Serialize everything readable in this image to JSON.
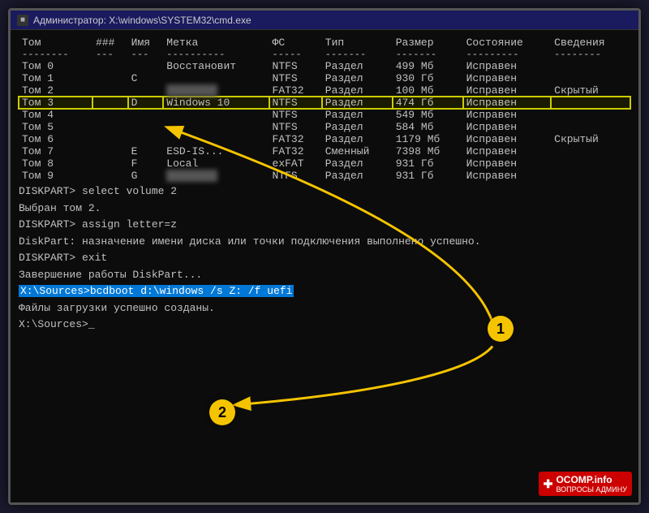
{
  "window": {
    "title": "Администратор: X:\\windows\\SYSTEM32\\cmd.exe"
  },
  "table": {
    "headers": [
      "Том",
      "###",
      "Имя",
      "Метка",
      "ФС",
      "Тип",
      "Размер",
      "Состояние",
      "Сведения"
    ],
    "separator": [
      "--------",
      "---",
      "---",
      "----------",
      "-----",
      "-------",
      "-------",
      "---------",
      "--------"
    ],
    "rows": [
      {
        "tom": "Том 0",
        "num": "",
        "name": "",
        "label": "Восстановит",
        "fs": "NTFS",
        "type": "Раздел",
        "size": "499 Мб",
        "status": "Исправен",
        "info": ""
      },
      {
        "tom": "Том 1",
        "num": "",
        "name": "C",
        "label": "",
        "fs": "NTFS",
        "type": "Раздел",
        "size": "930 Гб",
        "status": "Исправен",
        "info": ""
      },
      {
        "tom": "Том 2",
        "num": "",
        "name": "",
        "label": "",
        "fs": "FAT32",
        "type": "Раздел",
        "size": "100 Мб",
        "status": "Исправен",
        "info": "Скрытый"
      },
      {
        "tom": "Том 3",
        "num": "",
        "name": "D",
        "label": "Windows 10",
        "fs": "NTFS",
        "type": "Раздел",
        "size": "474 Гб",
        "status": "Исправен",
        "info": "",
        "highlight": true
      },
      {
        "tom": "Том 4",
        "num": "",
        "name": "",
        "label": "",
        "fs": "NTFS",
        "type": "Раздел",
        "size": "549 Мб",
        "status": "Исправен",
        "info": ""
      },
      {
        "tom": "Том 5",
        "num": "",
        "name": "",
        "label": "",
        "fs": "NTFS",
        "type": "Раздел",
        "size": "584 Мб",
        "status": "Исправен",
        "info": ""
      },
      {
        "tom": "Том 6",
        "num": "",
        "name": "",
        "label": "",
        "fs": "FAT32",
        "type": "Раздел",
        "size": "1179 Мб",
        "status": "Исправен",
        "info": "Скрытый"
      },
      {
        "tom": "Том 7",
        "num": "",
        "name": "E",
        "label": "ESD-IS...",
        "fs": "FAT32",
        "type": "Сменный",
        "size": "7398 Мб",
        "status": "Исправен",
        "info": ""
      },
      {
        "tom": "Том 8",
        "num": "",
        "name": "F",
        "label": "Local",
        "fs": "exFAT",
        "type": "Раздел",
        "size": "931 Гб",
        "status": "Исправен",
        "info": ""
      },
      {
        "tom": "Том 9",
        "num": "",
        "name": "G",
        "label": "BLURRED",
        "fs": "NTFS",
        "type": "Раздел",
        "size": "931 Гб",
        "status": "Исправен",
        "info": ""
      }
    ]
  },
  "commands": [
    {
      "text": "DISKPART> select volume 2"
    },
    {
      "text": "Выбран том 2."
    },
    {
      "text": ""
    },
    {
      "text": "DISKPART> assign letter=z"
    },
    {
      "text": ""
    },
    {
      "text": "DiskPart: назначение имени диска или точки подключения выполнено успешно."
    },
    {
      "text": ""
    },
    {
      "text": "DISKPART> exit"
    },
    {
      "text": ""
    },
    {
      "text": "Завершение работы DiskPart..."
    },
    {
      "text": ""
    },
    {
      "text": "X:\\Sources>bcdboot d:\\windows /s Z: /f uefi",
      "highlight": true
    },
    {
      "text": "Файлы загрузки успешно созданы."
    },
    {
      "text": ""
    },
    {
      "text": "X:\\Sources>_"
    }
  ],
  "badges": {
    "badge1": "1",
    "badge2": "2"
  },
  "watermark": {
    "text": "OCOMP.info",
    "subtext": "ВОПРОСЫ АДМИНУ"
  }
}
